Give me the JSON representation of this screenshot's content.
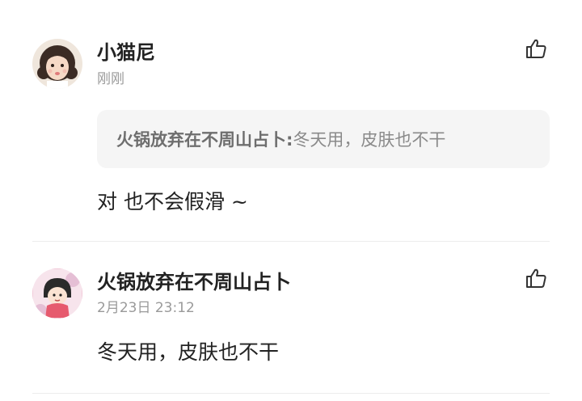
{
  "comments": [
    {
      "username": "小猫尼",
      "time": "刚刚",
      "quote": {
        "author": "火锅放弃在不周山占卜:",
        "text": "冬天用，皮肤也不干"
      },
      "content": "对 也不会假滑 ~",
      "avatar_icon": "girl-avatar",
      "like_icon": "thumbs-up-icon"
    },
    {
      "username": "火锅放弃在不周山占卜",
      "time": "2月23日 23:12",
      "content": "冬天用，皮肤也不干",
      "avatar_icon": "cartoon-girl-avatar",
      "like_icon": "thumbs-up-icon"
    }
  ],
  "colors": {
    "username": "#222222",
    "timestamp": "#9a9a9a",
    "quote_bg": "#f5f5f5",
    "divider": "#ececec"
  }
}
